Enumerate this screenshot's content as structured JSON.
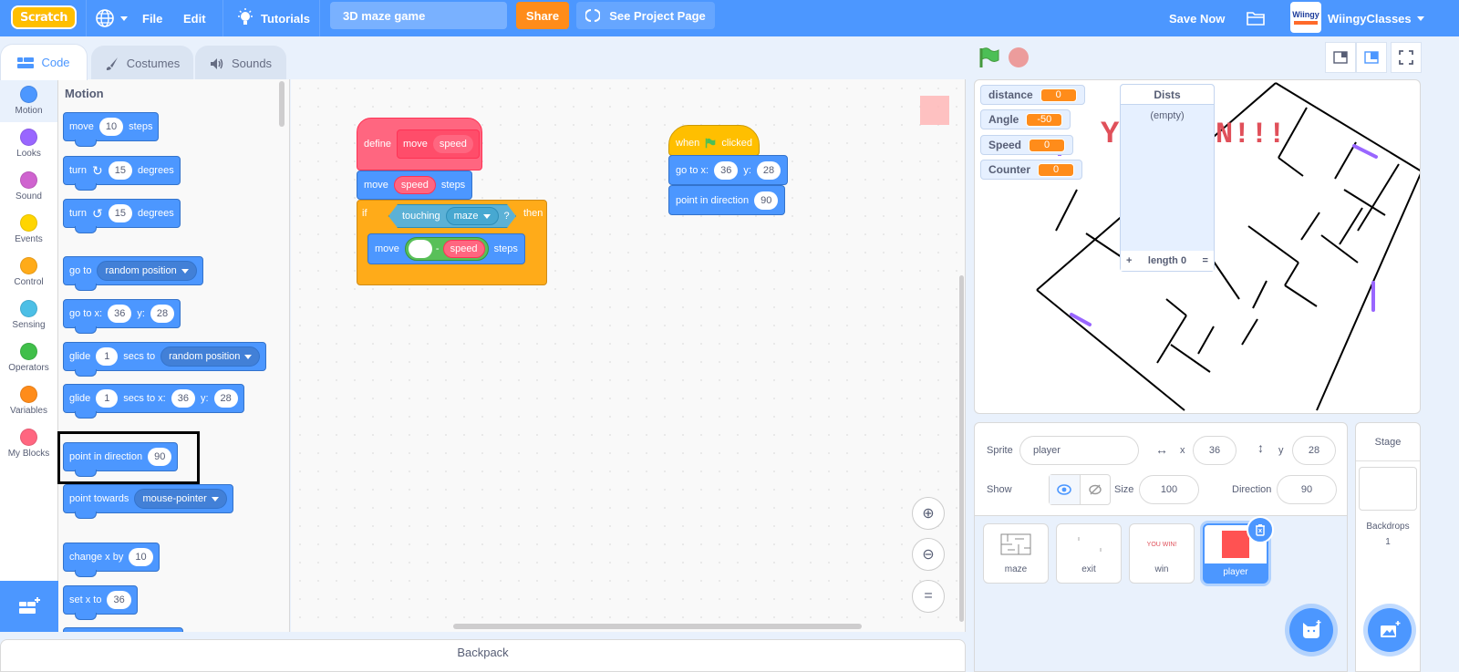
{
  "menubar": {
    "logo": "Scratch",
    "file": "File",
    "edit": "Edit",
    "tutorials": "Tutorials",
    "project_title": "3D maze game",
    "share": "Share",
    "see_project_page": "See Project Page",
    "save_now": "Save Now",
    "username": "WiingyClasses",
    "avatar_text": "Wiingy",
    "color": "#4c97ff"
  },
  "tabs": [
    {
      "label": "Code",
      "active": true
    },
    {
      "label": "Costumes",
      "active": false
    },
    {
      "label": "Sounds",
      "active": false
    }
  ],
  "categories": [
    {
      "label": "Motion",
      "color": "#4c97ff"
    },
    {
      "label": "Looks",
      "color": "#9966ff"
    },
    {
      "label": "Sound",
      "color": "#cf63cf"
    },
    {
      "label": "Events",
      "color": "#ffd500"
    },
    {
      "label": "Control",
      "color": "#ffab19"
    },
    {
      "label": "Sensing",
      "color": "#4cbfe6"
    },
    {
      "label": "Operators",
      "color": "#40bf4a"
    },
    {
      "label": "Variables",
      "color": "#ff8c1a"
    },
    {
      "label": "My Blocks",
      "color": "#ff6680"
    }
  ],
  "palette": {
    "heading": "Motion",
    "blocks": {
      "move": {
        "pre": "move",
        "val": "10",
        "post": "steps"
      },
      "turn_right": {
        "pre": "turn",
        "val": "15",
        "post": "degrees"
      },
      "turn_left": {
        "pre": "turn",
        "val": "15",
        "post": "degrees"
      },
      "goto": {
        "pre": "go to",
        "dropdown": "random position"
      },
      "goto_xy": {
        "pre": "go to x:",
        "x": "36",
        "ylabel": "y:",
        "y": "28"
      },
      "glide": {
        "pre": "glide",
        "val": "1",
        "mid": "secs to",
        "dropdown": "random position"
      },
      "glide_xy": {
        "pre": "glide",
        "val": "1",
        "mid": "secs to x:",
        "x": "36",
        "ylabel": "y:",
        "y": "28"
      },
      "point_dir": {
        "pre": "point in direction",
        "val": "90"
      },
      "point_towards": {
        "pre": "point towards",
        "dropdown": "mouse-pointer"
      },
      "change_x": {
        "pre": "change x by",
        "val": "10"
      },
      "set_x": {
        "pre": "set x to",
        "val": "36"
      }
    }
  },
  "script1": {
    "define": "define",
    "define_name": "move",
    "define_param": "speed",
    "move": "move",
    "move_param": "speed",
    "steps": "steps",
    "if": "if",
    "touching": "touching",
    "touching_target": "maze",
    "question": "?",
    "then": "then",
    "inner_move": "move",
    "minus": "-",
    "inner_param": "speed",
    "inner_steps": "steps"
  },
  "script2": {
    "when": "when",
    "clicked": "clicked",
    "goto_label": "go to x:",
    "x": "36",
    "ylabel": "y:",
    "y": "28",
    "point_label": "point in direction",
    "dir": "90"
  },
  "backpack": "Backpack",
  "stage": {
    "monitors": [
      {
        "name": "distance",
        "value": "0"
      },
      {
        "name": "Angle",
        "value": "-50"
      },
      {
        "name": "Speed",
        "value": "0"
      },
      {
        "name": "Counter",
        "value": "0"
      }
    ],
    "list": {
      "name": "Dists",
      "empty": "(empty)",
      "add": "+",
      "length": "length 0",
      "resize": "="
    },
    "banner_text": "YOU WON!!!"
  },
  "sprite_info": {
    "sprite_label": "Sprite",
    "sprite_name": "player",
    "x_label": "x",
    "x": "36",
    "y_label": "y",
    "y": "28",
    "show_label": "Show",
    "size_label": "Size",
    "size": "100",
    "direction_label": "Direction",
    "direction": "90"
  },
  "sprites": [
    {
      "name": "maze",
      "selected": false
    },
    {
      "name": "exit",
      "selected": false
    },
    {
      "name": "win",
      "selected": false,
      "thumb_text": "YOU WIN!"
    },
    {
      "name": "player",
      "selected": true
    }
  ],
  "stage_panel": {
    "title": "Stage",
    "backdrops_label": "Backdrops",
    "backdrops_count": "1"
  }
}
